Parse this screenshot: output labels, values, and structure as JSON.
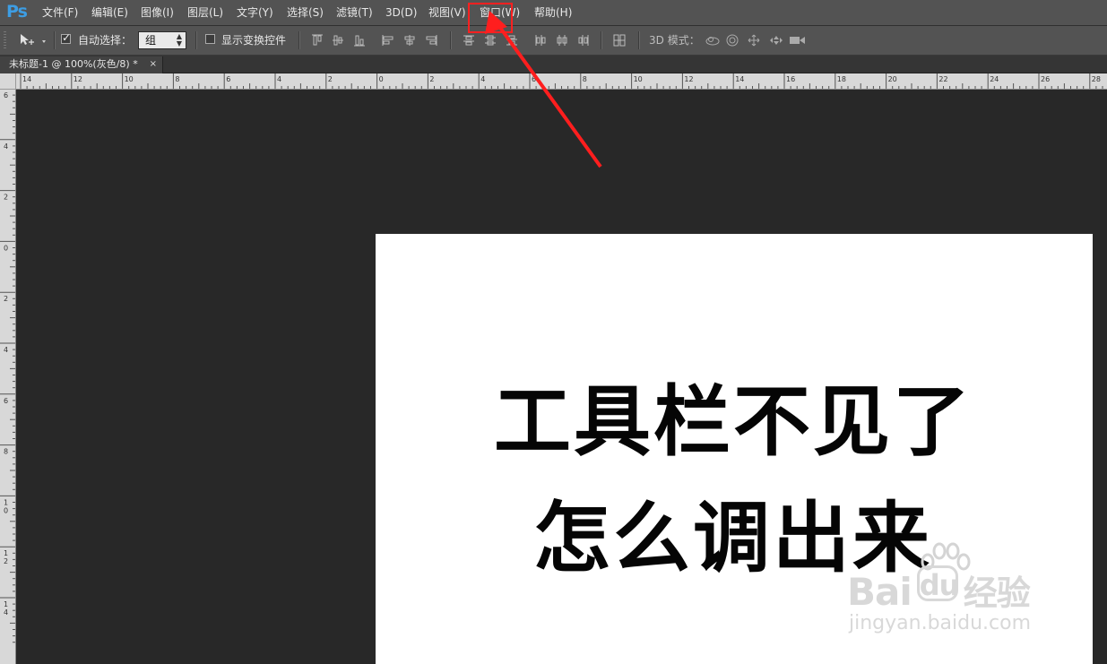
{
  "app": {
    "logo": "Ps"
  },
  "menu": [
    "文件(F)",
    "编辑(E)",
    "图像(I)",
    "图层(L)",
    "文字(Y)",
    "选择(S)",
    "滤镜(T)",
    "3D(D)",
    "视图(V)",
    "窗口(W)",
    "帮助(H)"
  ],
  "options": {
    "auto_select_label": "自动选择：",
    "auto_select_value": "组",
    "show_transform_label": "显示变换控件",
    "mode_3d_label": "3D 模式："
  },
  "tab": {
    "title": "未标题-1 @ 100%(灰色/8) *",
    "close": "×"
  },
  "ruler": {
    "h_labels": [
      "14",
      "12",
      "10",
      "8",
      "6",
      "4",
      "2",
      "0",
      "2",
      "4",
      "6",
      "8",
      "10",
      "12",
      "14",
      "16",
      "18",
      "20",
      "22",
      "24",
      "26",
      "28"
    ],
    "v_labels": [
      "6",
      "4",
      "2",
      "0",
      "2",
      "4",
      "6",
      "8",
      "10",
      "12",
      "14"
    ]
  },
  "canvas": {
    "line1": "工具栏不见了",
    "line2": "怎么调出来"
  },
  "watermark": {
    "brand": "Bai",
    "brand2": "du",
    "suffix": "经验",
    "url": "jingyan.baidu.com"
  },
  "colors": {
    "accent_red": "#ff2020",
    "ps_blue": "#3d9de3"
  }
}
